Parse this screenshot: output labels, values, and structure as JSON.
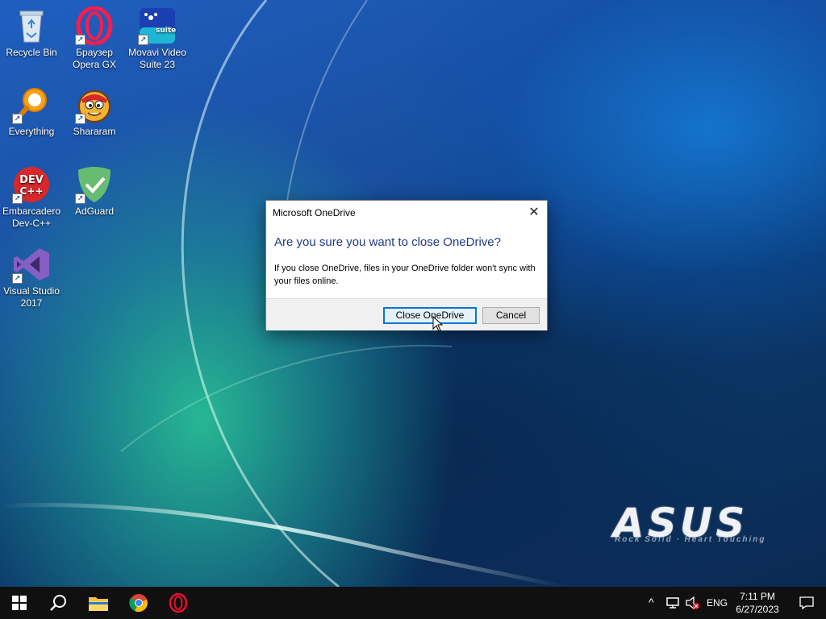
{
  "desktop": {
    "icons": [
      {
        "label": "Recycle Bin",
        "icon": "recycle-bin-icon"
      },
      {
        "label": "Браузер Opera GX",
        "icon": "opera-gx-icon"
      },
      {
        "label": "Movavi Video Suite 23",
        "icon": "movavi-icon",
        "badge": "suite"
      },
      {
        "label": "Everything",
        "icon": "everything-search-icon"
      },
      {
        "label": "Shararam",
        "icon": "shararam-icon"
      },
      {
        "label": "Embarcadero Dev-C++",
        "icon": "devcpp-icon",
        "badge": "DEV C++"
      },
      {
        "label": "AdGuard",
        "icon": "adguard-icon"
      },
      {
        "label": "Visual Studio 2017",
        "icon": "visual-studio-icon"
      }
    ],
    "wallpaper": {
      "brand": "ASUS",
      "tagline": "Rock Solid · Heart Touching"
    }
  },
  "dialog": {
    "title": "Microsoft OneDrive",
    "heading": "Are you sure you want to close OneDrive?",
    "body": "If you close OneDrive, files in your OneDrive folder won't sync with your files online.",
    "primary_button": "Close OneDrive",
    "cancel_button": "Cancel",
    "close_glyph": "✕"
  },
  "taskbar": {
    "apps": [
      "start-icon",
      "search-icon",
      "file-explorer-icon",
      "chrome-icon",
      "opera-icon"
    ],
    "tray": {
      "chevron": "^",
      "language": "ENG",
      "time": "7:11 PM",
      "date": "6/27/2023"
    }
  },
  "colors": {
    "accent": "#0078d7",
    "heading": "#1e3a8a",
    "taskbar": "#101010"
  }
}
